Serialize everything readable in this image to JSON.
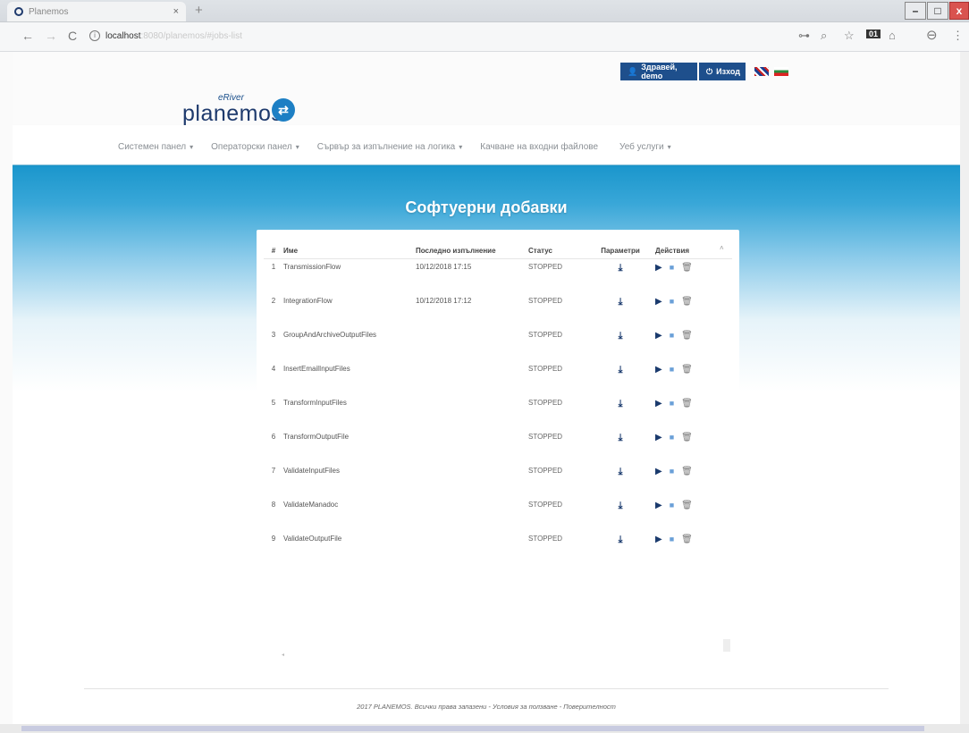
{
  "browser": {
    "tab_title": "Planemos",
    "tab_close": "×",
    "new_tab": "+",
    "url_host": "localhost",
    "url_path": ":8080/planemos/#jobs-list"
  },
  "header": {
    "brand_top": "eRiver",
    "brand_main": "planemos",
    "greet_label": "Здравей, demo",
    "exit_label": "Изход"
  },
  "nav": {
    "items": [
      {
        "label": "Системен панел",
        "caret": "▾"
      },
      {
        "label": "Операторски панел",
        "caret": "▾"
      },
      {
        "label": "Сървър за изпълнение на логика",
        "caret": "▾"
      },
      {
        "label": "Качване на входни файлове",
        "caret": ""
      },
      {
        "label": "Уеб услуги",
        "caret": "▾"
      }
    ]
  },
  "main": {
    "title": "Софтуерни добавки",
    "table": {
      "headers": [
        "#",
        "Име",
        "Последно изпълнение",
        "Статус",
        "Параметри",
        "Действия"
      ],
      "rows": [
        {
          "num": "1",
          "name": "TransmissionFlow",
          "last_run": "10/12/2018 17:15",
          "status": "STOPPED"
        },
        {
          "num": "2",
          "name": "IntegrationFlow",
          "last_run": "10/12/2018 17:12",
          "status": "STOPPED"
        },
        {
          "num": "3",
          "name": "GroupAndArchiveOutputFiles",
          "last_run": "",
          "status": "STOPPED"
        },
        {
          "num": "4",
          "name": "InsertEmailInputFiles",
          "last_run": "",
          "status": "STOPPED"
        },
        {
          "num": "5",
          "name": "TransformInputFiles",
          "last_run": "",
          "status": "STOPPED"
        },
        {
          "num": "6",
          "name": "TransformOutputFile",
          "last_run": "",
          "status": "STOPPED"
        },
        {
          "num": "7",
          "name": "ValidateInputFiles",
          "last_run": "",
          "status": "STOPPED"
        },
        {
          "num": "8",
          "name": "ValidateManadoc",
          "last_run": "",
          "status": "STOPPED"
        },
        {
          "num": "9",
          "name": "ValidateOutputFile",
          "last_run": "",
          "status": "STOPPED"
        }
      ]
    }
  },
  "footer": {
    "text": "2017 PLANEMOS. Всички права запазени - Условия за ползване - Поверителност"
  },
  "icons": {
    "download": "download-icon",
    "play": "play-icon",
    "stop": "stop-icon",
    "delete": "trash-icon"
  },
  "colors": {
    "brand_dark": "#1e4f8c",
    "band_blue": "#1a96cc"
  }
}
